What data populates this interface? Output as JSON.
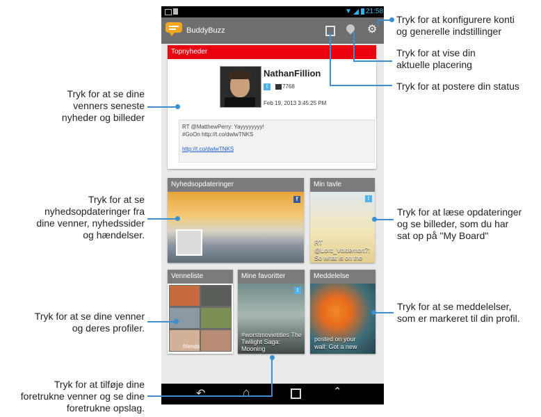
{
  "app": {
    "status_time": "21:58",
    "name": "BuddyBuzz"
  },
  "top_news": {
    "header": "Topnyheder",
    "user_name": "NathanFillion",
    "follower_count": "7768",
    "timestamp": "Feb 19, 2013 3:45:25 PM",
    "tweet_line1": "RT @MatthewPerry: Yayyyyyyyy!",
    "tweet_line2": "#GoOn http://t.co/dwlwTNKS",
    "tweet_link": "http://t.co/dwlwTNKS"
  },
  "tiles": {
    "news_updates": "Nyhedsopdateringer",
    "my_board": "Min tavle",
    "my_board_caption_line1": "RT",
    "my_board_caption_line2": "@Lord_Voldemort7:",
    "my_board_caption_line3": "So what is on the",
    "friends_list": "Venneliste",
    "friends_caption": "friends",
    "favorites": "Mine favoritter",
    "favorites_caption": "#worstmovietitles The Twilight Saga: Mooning",
    "notification": "Meddelelse",
    "notification_caption1": "posted on your",
    "notification_caption2": "wall: Got a new"
  },
  "callouts": {
    "settings": [
      "Tryk for at konfigurere konti",
      "og generelle indstillinger"
    ],
    "location": [
      "Tryk for at vise din",
      "aktuelle placering"
    ],
    "post": [
      "Tryk for at postere din status"
    ],
    "top_news": [
      "Tryk for at se dine",
      "venners seneste",
      "nyheder og billeder"
    ],
    "news_updates": [
      "Tryk for at se",
      "nyhedsopdateringer fra",
      "dine venner, nyhedssider",
      "og hændelser."
    ],
    "my_board": [
      "Tryk for at læse opdateringer",
      "og se billeder, som du har",
      "sat op på \"My Board\""
    ],
    "friends": [
      "Tryk for at se dine venner",
      "og deres profiler."
    ],
    "notifications": [
      "Tryk for at se meddelelser,",
      "som er markeret til din profil."
    ],
    "favorites": [
      "Tryk for at tilføje dine",
      "foretrukne venner og se dine",
      "foretrukne opslag."
    ]
  },
  "colors": {
    "accent_blue": "#3b8fd0",
    "top_news_red": "#e8000f",
    "action_bar_gray": "#6e6e6e"
  }
}
